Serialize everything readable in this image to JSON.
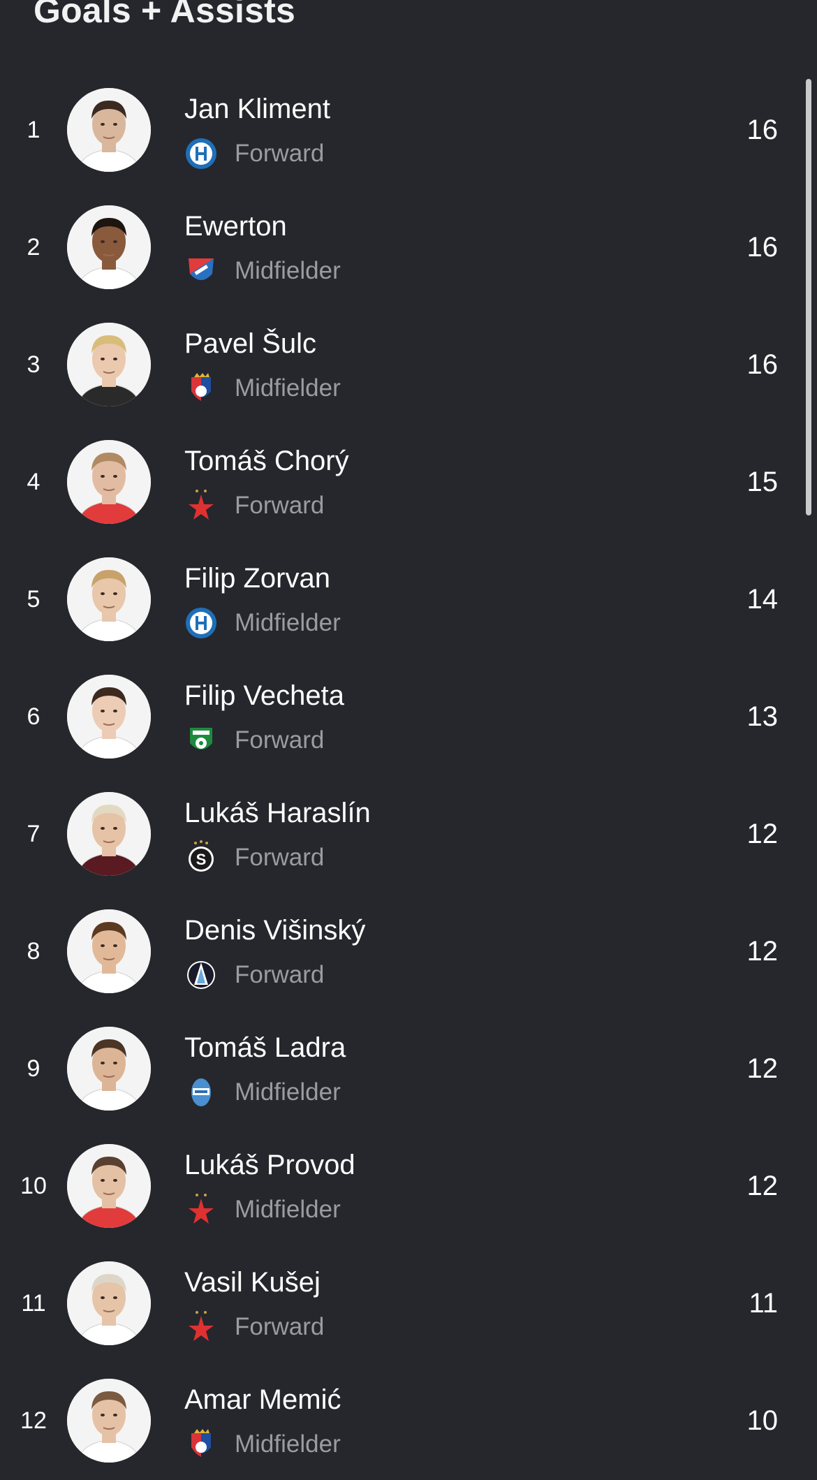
{
  "header": {
    "title": "Goals + Assists"
  },
  "players": [
    {
      "rank": "1",
      "name": "Jan Kliment",
      "position": "Forward",
      "value": "16",
      "club_icon": "sigma-olomouc-crest-icon",
      "skin": "#d9b79c",
      "hair": "#3a2a20",
      "shirt": "#ffffff"
    },
    {
      "rank": "2",
      "name": "Ewerton",
      "position": "Midfielder",
      "value": "16",
      "club_icon": "banik-ostrava-crest-icon",
      "skin": "#8a5a3c",
      "hair": "#1d1510",
      "shirt": "#ffffff"
    },
    {
      "rank": "3",
      "name": "Pavel Šulc",
      "position": "Midfielder",
      "value": "16",
      "club_icon": "viktoria-plzen-crest-icon",
      "skin": "#eac9ae",
      "hair": "#d8bd7a",
      "shirt": "#2a2a2a"
    },
    {
      "rank": "4",
      "name": "Tomáš Chorý",
      "position": "Forward",
      "value": "15",
      "club_icon": "slavia-star-crest-icon",
      "skin": "#e2bca2",
      "hair": "#b08a62",
      "shirt": "#e23b3b"
    },
    {
      "rank": "5",
      "name": "Filip Zorvan",
      "position": "Midfielder",
      "value": "14",
      "club_icon": "sigma-olomouc-crest-icon",
      "skin": "#e8c7aa",
      "hair": "#c8a26a",
      "shirt": "#ffffff"
    },
    {
      "rank": "6",
      "name": "Filip Vecheta",
      "position": "Forward",
      "value": "13",
      "club_icon": "karvina-crest-icon",
      "skin": "#ecccb4",
      "hair": "#3d2a1e",
      "shirt": "#ffffff"
    },
    {
      "rank": "7",
      "name": "Lukáš Haraslín",
      "position": "Forward",
      "value": "12",
      "club_icon": "sparta-crest-icon",
      "skin": "#e6c3a6",
      "hair": "#e3d9c2",
      "shirt": "#5a1a22"
    },
    {
      "rank": "8",
      "name": "Denis Višinský",
      "position": "Forward",
      "value": "12",
      "club_icon": "liberec-crest-icon",
      "skin": "#e2b998",
      "hair": "#5b3a22",
      "shirt": "#ffffff"
    },
    {
      "rank": "9",
      "name": "Tomáš Ladra",
      "position": "Midfielder",
      "value": "12",
      "club_icon": "mlada-boleslav-crest-icon",
      "skin": "#dcb596",
      "hair": "#4a3526",
      "shirt": "#ffffff"
    },
    {
      "rank": "10",
      "name": "Lukáš Provod",
      "position": "Midfielder",
      "value": "12",
      "club_icon": "slavia-star-crest-icon",
      "skin": "#e4c0a4",
      "hair": "#5a4030",
      "shirt": "#e23b3b"
    },
    {
      "rank": "11",
      "name": "Vasil Kušej",
      "position": "Forward",
      "value": "11",
      "club_icon": "slavia-star-crest-icon",
      "skin": "#e6c4a8",
      "hair": "#ddd6c8",
      "shirt": "#ffffff"
    },
    {
      "rank": "12",
      "name": "Amar Memić",
      "position": "Midfielder",
      "value": "10",
      "club_icon": "viktoria-plzen-crest-icon",
      "skin": "#e5c2a6",
      "hair": "#7a5a40",
      "shirt": "#ffffff"
    }
  ]
}
